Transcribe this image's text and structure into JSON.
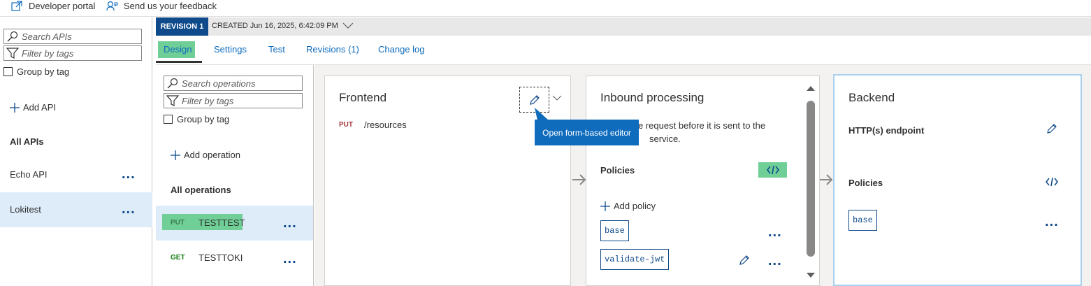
{
  "topbar": {
    "developer_portal": "Developer portal",
    "feedback": "Send us your feedback"
  },
  "apis": {
    "search_placeholder": "Search APIs",
    "filter_placeholder": "Filter by tags",
    "group_by_tag": "Group by tag",
    "add_api": "Add API",
    "all_apis": "All APIs",
    "items": [
      {
        "name": "Echo API"
      },
      {
        "name": "Lokitest"
      }
    ]
  },
  "revision": {
    "badge": "REVISION 1",
    "created": "CREATED Jun 16, 2025, 6:42:09 PM"
  },
  "tabs": [
    "Design",
    "Settings",
    "Test",
    "Revisions (1)",
    "Change log"
  ],
  "operations": {
    "search_placeholder": "Search operations",
    "filter_placeholder": "Filter by tags",
    "group_by_tag": "Group by tag",
    "add_operation": "Add operation",
    "all_operations": "All operations",
    "items": [
      {
        "method": "PUT",
        "name": "TESTTEST"
      },
      {
        "method": "GET",
        "name": "TESTTOKI"
      }
    ]
  },
  "frontend": {
    "title": "Frontend",
    "method": "PUT",
    "path": "/resources",
    "tooltip": "Open form-based editor"
  },
  "inbound": {
    "title": "Inbound processing",
    "desc_line1": "e request before it is sent to the",
    "desc_line2": "service.",
    "policies_label": "Policies",
    "add_policy": "Add policy",
    "policies": [
      "base",
      "validate-jwt"
    ]
  },
  "backend": {
    "title": "Backend",
    "endpoint_label": "HTTP(s) endpoint",
    "policies_label": "Policies",
    "policies": [
      "base"
    ]
  },
  "colors": {
    "accent": "#0f6cbd",
    "brand_dark": "#0f4a8a",
    "highlight": "#6fcf97",
    "selected": "#deecf9"
  }
}
